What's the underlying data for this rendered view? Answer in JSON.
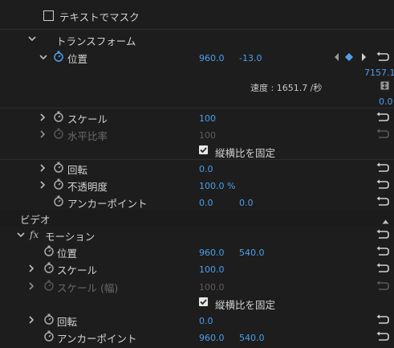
{
  "mask": {
    "text_mask_label": "テキストでマスク"
  },
  "transform": {
    "header": "トランスフォーム",
    "position": {
      "label": "位置",
      "x": "960.0",
      "y": "-13.0"
    },
    "graph": {
      "top_value": "7157.1",
      "speed_label": "速度 : 1651.7 /秒",
      "bottom_value": "0.0"
    },
    "scale": {
      "label": "スケール",
      "value": "100"
    },
    "scale_width": {
      "label": "水平比率",
      "value": "100"
    },
    "uniform": {
      "label": "縦横比を固定"
    },
    "rotation": {
      "label": "回転",
      "value": "0.0"
    },
    "opacity": {
      "label": "不透明度",
      "value": "100.0 %"
    },
    "anchor": {
      "label": "アンカーポイント",
      "x": "0.0",
      "y": "0.0"
    }
  },
  "video": {
    "header": "ビデオ",
    "fx_label": "fx",
    "motion": {
      "label": "モーション",
      "position": {
        "label": "位置",
        "x": "960.0",
        "y": "540.0"
      },
      "scale": {
        "label": "スケール",
        "value": "100.0"
      },
      "scale_width": {
        "label": "スケール (幅)",
        "value": "100.0"
      },
      "uniform": {
        "label": "縦横比を固定"
      },
      "rotation": {
        "label": "回転",
        "value": "0.0"
      },
      "anchor": {
        "label": "アンカーポイント",
        "x": "960.0",
        "y": "540.0"
      }
    }
  },
  "colors": {
    "accent": "#4c9fee",
    "background": "#1d1d1d",
    "text": "#c8c8c8",
    "disabled": "#5e5e5e"
  }
}
